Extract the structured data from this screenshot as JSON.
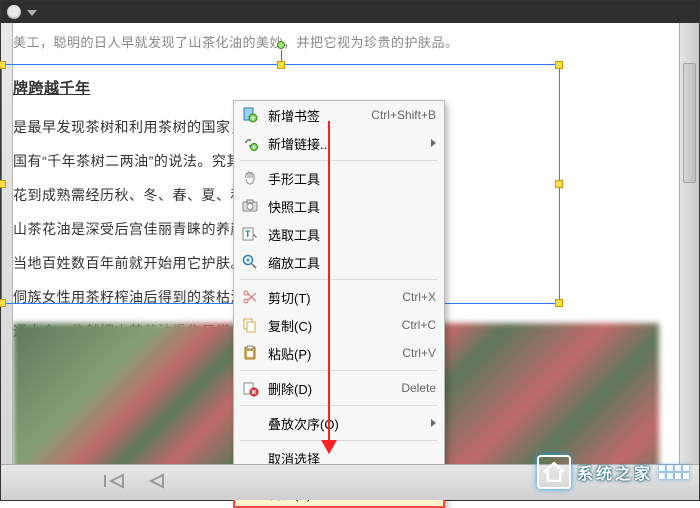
{
  "document": {
    "faint_line": "美工，聪明的日人早就发现了山茶化油的美妙，并把它视为珍贵的护肤品。",
    "heading": "牌跨越千年",
    "p1": "是最早发现茶树和利用茶树的国家，据                                          中国。不过山茶花",
    "p2": "国有“千年茶树二两油”的说法。究其原                                     年，而山茶果从开",
    "p3": "花到成熟需经历秋、冬、春、夏、秋五季，",
    "p4": "山茶花油是深受后宫佳丽青睐的养颜秘                                          美容奇效。在一些",
    "p5": "当地百姓数百年前就开始用它护肤。譬                                          浴，皮肤极富弹性，",
    "p6": "侗族女性用茶籽榨油后得到的茶枯洗                                           ，从名媛到明星，",
    "p7": "通大众，依然把山茶花油看作日常护肤"
  },
  "context_menu": {
    "new_bookmark": "新增书签",
    "new_bookmark_sc": "Ctrl+Shift+B",
    "new_link": "新增链接...",
    "hand_tool": "手形工具",
    "snapshot_tool": "快照工具",
    "select_tool": "选取工具",
    "zoom_tool": "缩放工具",
    "cut": "剪切(T)",
    "cut_sc": "Ctrl+X",
    "copy": "复制(C)",
    "copy_sc": "Ctrl+C",
    "paste": "粘贴(P)",
    "paste_sc": "Ctrl+V",
    "delete": "删除(D)",
    "delete_sc": "Delete",
    "stacking_order": "叠放次序(O)",
    "deselect": "取消选择",
    "properties": "属性(P)..."
  },
  "watermark": {
    "text": "系统之家"
  }
}
